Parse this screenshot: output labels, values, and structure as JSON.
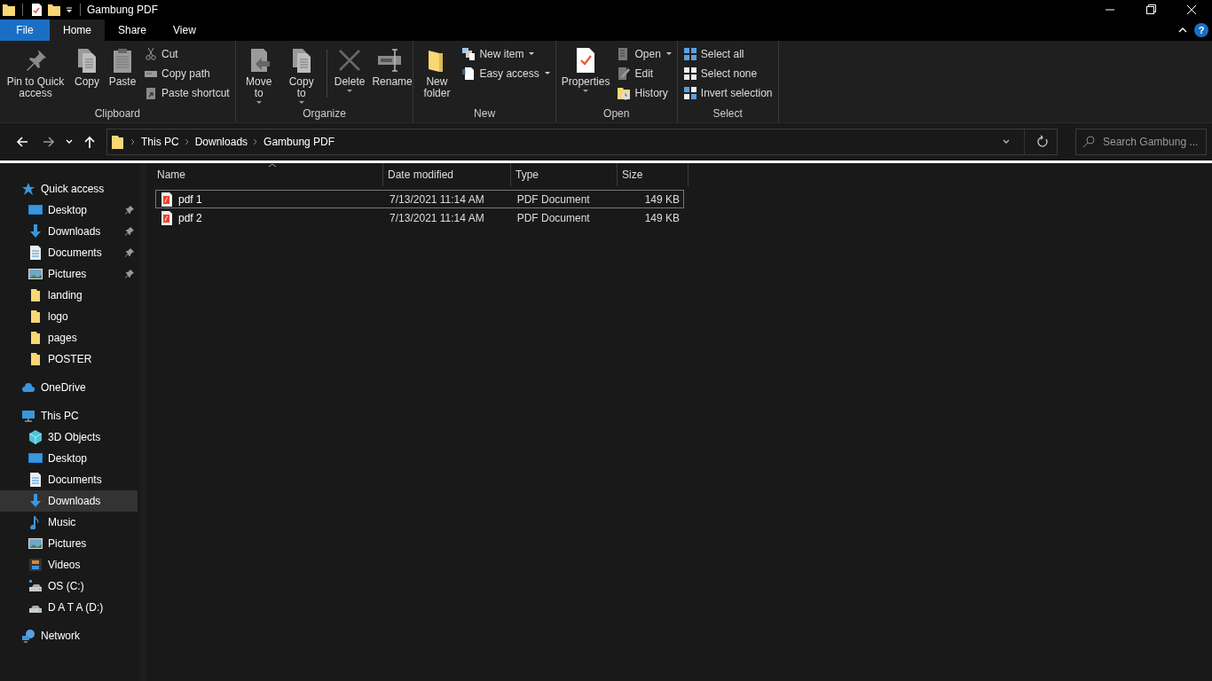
{
  "window": {
    "title": "Gambung PDF"
  },
  "ribbon_tabs": [
    {
      "label": "File",
      "kind": "file",
      "selected": false
    },
    {
      "label": "Home",
      "kind": "tab",
      "selected": true
    },
    {
      "label": "Share",
      "kind": "tab",
      "selected": false
    },
    {
      "label": "View",
      "kind": "tab",
      "selected": false
    }
  ],
  "help_button": "?",
  "ribbon_groups": [
    {
      "label": "Clipboard",
      "items": [
        {
          "kind": "large",
          "label": "Pin to Quick access",
          "dropdown": false
        },
        {
          "kind": "large",
          "label": "Copy",
          "dropdown": false
        },
        {
          "kind": "large",
          "label": "Paste",
          "dropdown": false
        },
        {
          "kind": "small",
          "label": "Cut",
          "dropdown": false
        },
        {
          "kind": "small",
          "label": "Copy path",
          "dropdown": false
        },
        {
          "kind": "small",
          "label": "Paste shortcut",
          "dropdown": false
        }
      ]
    },
    {
      "label": "Organize",
      "items": [
        {
          "kind": "large",
          "label": "Move to",
          "dropdown": true
        },
        {
          "kind": "large",
          "label": "Copy to",
          "dropdown": true
        },
        {
          "kind": "large",
          "label": "Delete",
          "dropdown": true
        },
        {
          "kind": "large",
          "label": "Rename",
          "dropdown": false
        }
      ]
    },
    {
      "label": "New",
      "items": [
        {
          "kind": "large",
          "label": "New folder",
          "dropdown": false
        },
        {
          "kind": "small",
          "label": "New item",
          "dropdown": true
        },
        {
          "kind": "small",
          "label": "Easy access",
          "dropdown": true
        }
      ]
    },
    {
      "label": "Open",
      "items": [
        {
          "kind": "large",
          "label": "Properties",
          "dropdown": true
        },
        {
          "kind": "small",
          "label": "Open",
          "dropdown": true
        },
        {
          "kind": "small",
          "label": "Edit",
          "dropdown": false
        },
        {
          "kind": "small",
          "label": "History",
          "dropdown": false
        }
      ]
    },
    {
      "label": "Select",
      "items": [
        {
          "kind": "small",
          "label": "Select all",
          "dropdown": false
        },
        {
          "kind": "small",
          "label": "Select none",
          "dropdown": false
        },
        {
          "kind": "small",
          "label": "Invert selection",
          "dropdown": false
        }
      ]
    }
  ],
  "breadcrumbs": [
    "This PC",
    "Downloads",
    "Gambung PDF"
  ],
  "search": {
    "placeholder": "Search Gambung ..."
  },
  "sidebar": [
    {
      "label": "Quick access",
      "selected": false,
      "children": [
        {
          "label": "Desktop",
          "pinned": true,
          "selected": false
        },
        {
          "label": "Downloads",
          "pinned": true,
          "selected": false
        },
        {
          "label": "Documents",
          "pinned": true,
          "selected": false
        },
        {
          "label": "Pictures",
          "pinned": true,
          "selected": false
        },
        {
          "label": "landing",
          "pinned": false,
          "selected": false
        },
        {
          "label": "logo",
          "pinned": false,
          "selected": false
        },
        {
          "label": "pages",
          "pinned": false,
          "selected": false
        },
        {
          "label": "POSTER",
          "pinned": false,
          "selected": false
        }
      ]
    },
    {
      "label": "OneDrive",
      "selected": false
    },
    {
      "label": "This PC",
      "selected": false,
      "children": [
        {
          "label": "3D Objects",
          "pinned": false,
          "selected": false
        },
        {
          "label": "Desktop",
          "pinned": false,
          "selected": false
        },
        {
          "label": "Documents",
          "pinned": false,
          "selected": false
        },
        {
          "label": "Downloads",
          "pinned": false,
          "selected": true
        },
        {
          "label": "Music",
          "pinned": false,
          "selected": false
        },
        {
          "label": "Pictures",
          "pinned": false,
          "selected": false
        },
        {
          "label": "Videos",
          "pinned": false,
          "selected": false
        },
        {
          "label": "OS (C:)",
          "pinned": false,
          "selected": false
        },
        {
          "label": "D A T A (D:)",
          "pinned": false,
          "selected": false
        }
      ]
    },
    {
      "label": "Network",
      "selected": false
    }
  ],
  "table": {
    "columns": [
      "Name",
      "Date modified",
      "Type",
      "Size"
    ],
    "rows": [
      {
        "name": "pdf 1",
        "date_modified": "7/13/2021 11:14 AM",
        "type": "PDF Document",
        "size": "149 KB",
        "selected": true
      },
      {
        "name": "pdf 2",
        "date_modified": "7/13/2021 11:14 AM",
        "type": "PDF Document",
        "size": "149 KB",
        "selected": false
      }
    ]
  }
}
